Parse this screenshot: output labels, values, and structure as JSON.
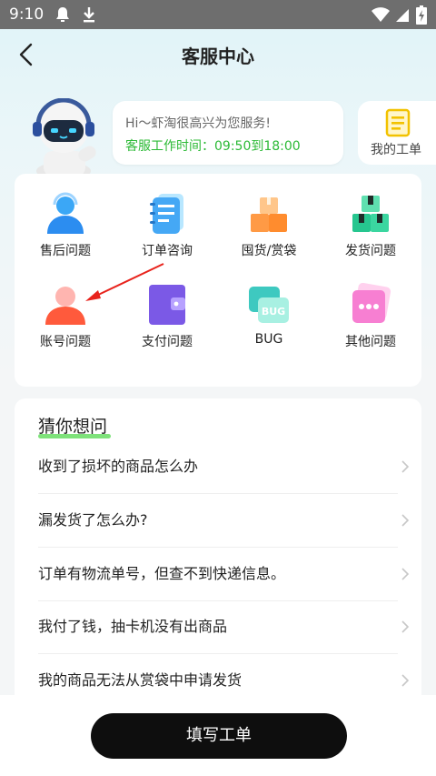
{
  "status_bar": {
    "time": "9:10"
  },
  "header": {
    "title": "客服中心"
  },
  "greeting": {
    "line1": "Hi～虾淘很高兴为您服务!",
    "line2": "客服工作时间：09:50到18:00"
  },
  "ticket": {
    "label": "我的工单"
  },
  "categories": [
    {
      "label": "售后问题",
      "icon": "headset-person-icon"
    },
    {
      "label": "订单咨询",
      "icon": "notebook-icon"
    },
    {
      "label": "囤货/赏袋",
      "icon": "boxes-icon"
    },
    {
      "label": "发货问题",
      "icon": "gift-boxes-icon"
    },
    {
      "label": "账号问题",
      "icon": "user-icon"
    },
    {
      "label": "支付问题",
      "icon": "wallet-icon"
    },
    {
      "label": "BUG",
      "icon": "bug-card-icon"
    },
    {
      "label": "其他问题",
      "icon": "chat-dots-icon"
    }
  ],
  "guess": {
    "title": "猜你想问",
    "questions": [
      "收到了损坏的商品怎么办",
      "漏发货了怎么办?",
      "订单有物流单号，但查不到快递信息。",
      "我付了钱，抽卡机没有出商品",
      "我的商品无法从赏袋中申请发货"
    ]
  },
  "submit": {
    "label": "填写工单"
  },
  "colors": {
    "accent_green": "#2cba36",
    "button": "#0e0e0e"
  }
}
